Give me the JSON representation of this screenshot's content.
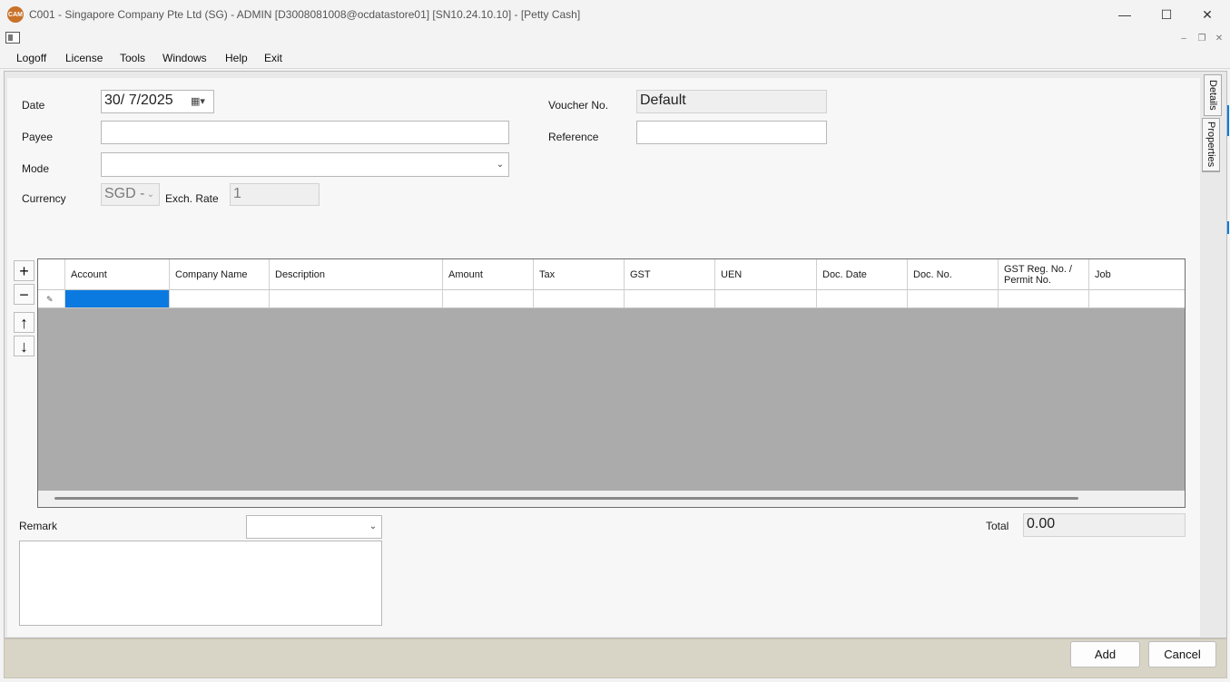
{
  "window": {
    "logo_text": "CAM",
    "title": "C001 - Singapore Company Pte Ltd (SG) - ADMIN [D3008081008@ocdatastore01] [SN10.24.10.10] - [Petty Cash]",
    "minimize": "—",
    "maximize": "☐",
    "close": "✕"
  },
  "mdi": {
    "minimize": "–",
    "restore": "❐",
    "close": "✕"
  },
  "menu": [
    "Logoff",
    "License",
    "Tools",
    "Windows",
    "Help",
    "Exit"
  ],
  "side_tabs": [
    "Details",
    "Properties"
  ],
  "form": {
    "date_label": "Date",
    "date_value": "30/  7/2025",
    "payee_label": "Payee",
    "payee_value": "",
    "mode_label": "Mode",
    "mode_value": "",
    "currency_label": "Currency",
    "currency_value": "SGD -",
    "exch_rate_label": "Exch. Rate",
    "exch_rate_value": "1",
    "voucher_label": "Voucher No.",
    "voucher_value": "Default",
    "reference_label": "Reference",
    "reference_value": ""
  },
  "grid": {
    "columns": [
      "Account",
      "Company Name",
      "Description",
      "Amount",
      "Tax",
      "GST",
      "UEN",
      "Doc. Date",
      "Doc. No.",
      "GST Reg. No. / Permit No.",
      "Job"
    ],
    "row_marker": "✎"
  },
  "tools": {
    "add": "+",
    "remove": "−",
    "up": "↑",
    "down": "↓"
  },
  "footer": {
    "remark_label": "Remark",
    "remark_value": "",
    "total_label": "Total",
    "total_value": "0.00"
  },
  "buttons": {
    "add": "Add",
    "cancel": "Cancel"
  },
  "colors": {
    "selection": "#0a7ae0",
    "bottom_bar": "#d8d4c6",
    "grid_empty": "#ababab"
  }
}
